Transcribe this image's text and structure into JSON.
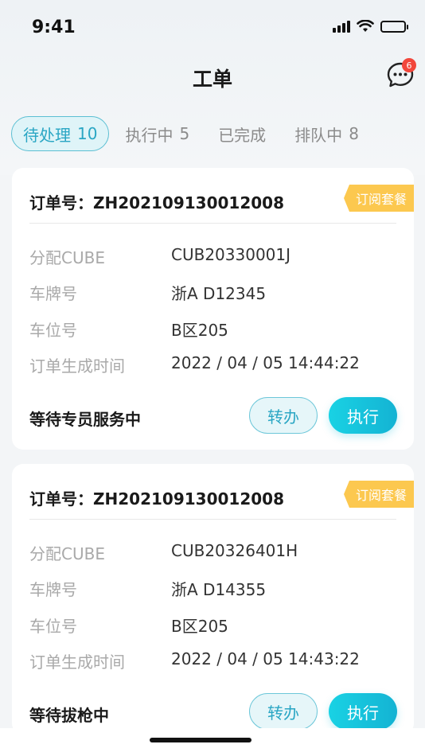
{
  "status_bar": {
    "time": "9:41",
    "icons": [
      "cellular-signal-icon",
      "wifi-icon",
      "battery-icon"
    ]
  },
  "nav": {
    "title": "工单",
    "message_icon": "chat-bubble-icon",
    "message_badge": "6"
  },
  "tabs": [
    {
      "label": "待处理",
      "count": "10",
      "active": true
    },
    {
      "label": "执行中",
      "count": "5",
      "active": false
    },
    {
      "label": "已完成",
      "count": "",
      "active": false
    },
    {
      "label": "排队中",
      "count": "8",
      "active": false
    }
  ],
  "orders": [
    {
      "order_label": "订单号：",
      "order_no": "ZH202109130012008",
      "tag": "订阅套餐",
      "fields": [
        {
          "label": "分配CUBE",
          "value": "CUB20330001J"
        },
        {
          "label": "车牌号",
          "value": "浙A D12345"
        },
        {
          "label": "车位号",
          "value": "B区205"
        },
        {
          "label": "订单生成时间",
          "value": "2022 / 04 / 05  14:44:22"
        }
      ],
      "status": "等待专员服务中",
      "transfer_label": "转办",
      "execute_label": "执行"
    },
    {
      "order_label": "订单号：",
      "order_no": "ZH202109130012008",
      "tag": "订阅套餐",
      "fields": [
        {
          "label": "分配CUBE",
          "value": "CUB20326401H"
        },
        {
          "label": "车牌号",
          "value": "浙A D14355"
        },
        {
          "label": "车位号",
          "value": "B区205"
        },
        {
          "label": "订单生成时间",
          "value": "2022 / 04 / 05  14:43:22"
        }
      ],
      "status": "等待拔枪中",
      "transfer_label": "转办",
      "execute_label": "执行"
    }
  ],
  "colors": {
    "accent": "#2aa6c4",
    "execute_gradient_start": "#19d2e4",
    "execute_gradient_end": "#14b3d3",
    "tag": "#fcc84f",
    "badge": "#f2463b"
  }
}
